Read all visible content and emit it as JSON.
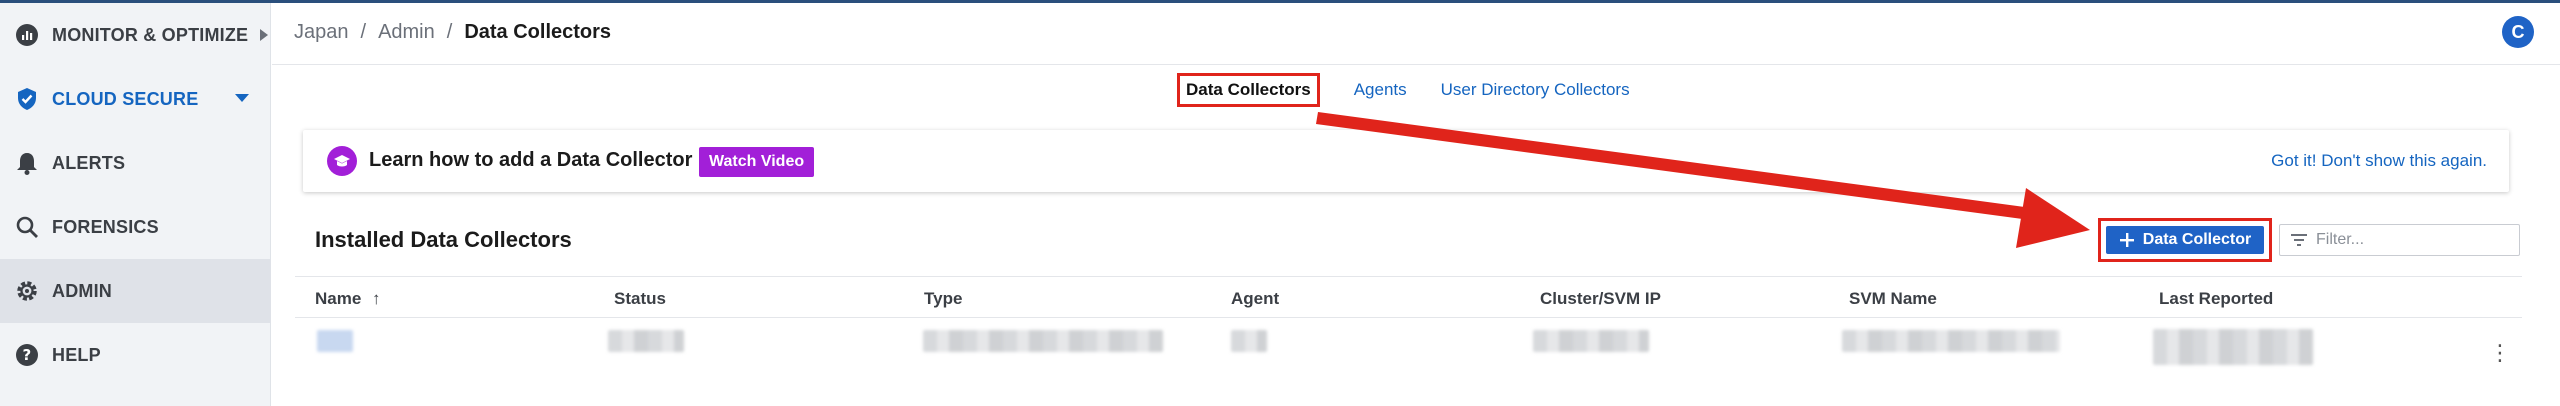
{
  "sidebar": {
    "items": [
      {
        "label": "MONITOR & OPTIMIZE",
        "icon": "chart-icon"
      },
      {
        "label": "CLOUD SECURE",
        "icon": "shield-icon"
      },
      {
        "label": "ALERTS",
        "icon": "bell-icon"
      },
      {
        "label": "FORENSICS",
        "icon": "search-icon"
      },
      {
        "label": "ADMIN",
        "icon": "gear-icon"
      },
      {
        "label": "HELP",
        "icon": "help-icon"
      }
    ]
  },
  "header": {
    "breadcrumb": {
      "root": "Japan",
      "middle": "Admin",
      "current": "Data Collectors",
      "sep": "/"
    },
    "help_icon_label": "C"
  },
  "tabs": [
    {
      "label": "Data Collectors",
      "active": true
    },
    {
      "label": "Agents",
      "active": false
    },
    {
      "label": "User Directory Collectors",
      "active": false
    }
  ],
  "banner": {
    "text": "Learn how to add a Data Collector",
    "watch_label": "Watch Video",
    "dismiss_label": "Got it! Don't show this again."
  },
  "section": {
    "title": "Installed Data Collectors",
    "add_label": "Data Collector",
    "filter_placeholder": "Filter..."
  },
  "table": {
    "columns": [
      "Name",
      "Status",
      "Type",
      "Agent",
      "Cluster/SVM IP",
      "SVM Name",
      "Last Reported"
    ],
    "sort_indicator": "↑"
  },
  "colors": {
    "accent": "#1f63c6",
    "link": "#1565c0",
    "purple": "#a21fd8",
    "annotation_red": "#e0241b"
  }
}
